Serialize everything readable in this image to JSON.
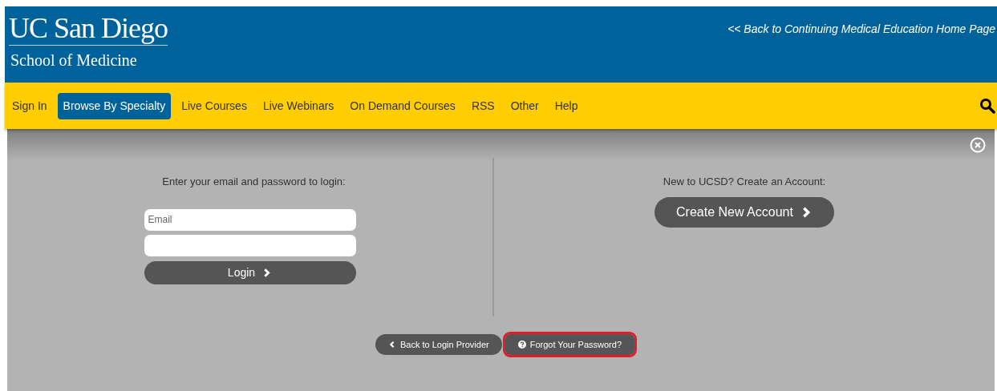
{
  "header": {
    "logo_title": "UC San Diego",
    "logo_subtitle": "School of Medicine",
    "back_link": "<< Back to Continuing Medical Education Home Page"
  },
  "nav": [
    {
      "label": "Sign In",
      "selected": false
    },
    {
      "label": "Browse By Specialty",
      "selected": true
    },
    {
      "label": "Live Courses",
      "selected": false
    },
    {
      "label": "Live Webinars",
      "selected": false
    },
    {
      "label": "On Demand Courses",
      "selected": false
    },
    {
      "label": "RSS",
      "selected": false
    },
    {
      "label": "Other",
      "selected": false
    },
    {
      "label": "Help",
      "selected": false
    }
  ],
  "login": {
    "prompt": "Enter your email and password to login:",
    "email_placeholder": "Email",
    "button": "Login"
  },
  "register": {
    "prompt": "New to UCSD? Create an Account:",
    "button": "Create New Account"
  },
  "footer_buttons": [
    {
      "kind": "back",
      "label": "Back to Login Provider",
      "highlighted": false
    },
    {
      "kind": "help",
      "label": "Forgot Your Password?",
      "highlighted": true
    }
  ]
}
